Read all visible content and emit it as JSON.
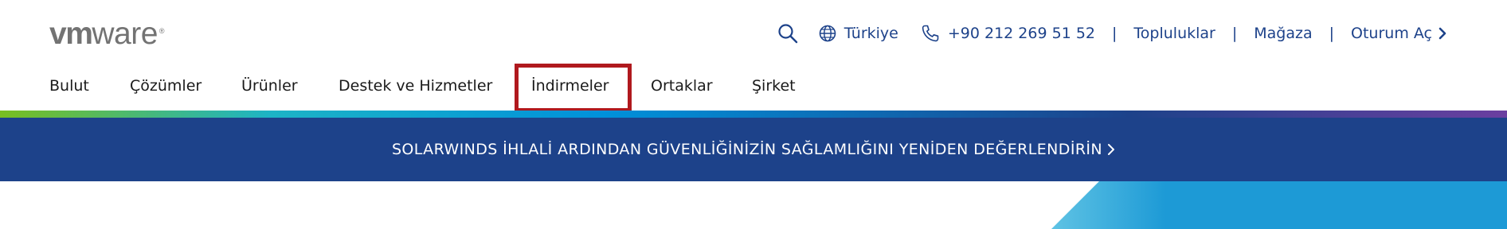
{
  "brand": {
    "logo_vm": "vm",
    "logo_ware": "ware",
    "logo_reg": "®",
    "color_text": "#737373"
  },
  "utility": {
    "search_icon": "search-icon",
    "globe_icon": "globe-icon",
    "region": "Türkiye",
    "phone_icon": "phone-icon",
    "phone": "+90 212 269 51 52",
    "separator": "|",
    "communities": "Topluluklar",
    "store": "Mağaza",
    "login": "Oturum Aç",
    "login_icon": "chevron-right-icon",
    "color": "#1d428a"
  },
  "nav": {
    "items": [
      {
        "label": "Bulut"
      },
      {
        "label": "Çözümler"
      },
      {
        "label": "Ürünler"
      },
      {
        "label": "Destek ve Hizmetler"
      },
      {
        "label": "İndirmeler",
        "highlighted": true
      },
      {
        "label": "Ortaklar"
      },
      {
        "label": "Şirket"
      }
    ],
    "highlight_color": "#b0191e"
  },
  "banner": {
    "text": "SOLARWINDS İHLALİ ARDINDAN GÜVENLİĞİNİZİN SAĞLAMLIĞINI YENİDEN DEĞERLENDİRİN",
    "icon": "chevron-right-icon",
    "background": "#1d428a"
  },
  "colors": {
    "stripe": [
      "#78be20",
      "#1db4c6",
      "#0091da",
      "#1d428a",
      "#6b3fa0"
    ],
    "hero_blue": "#1d9ad6"
  }
}
